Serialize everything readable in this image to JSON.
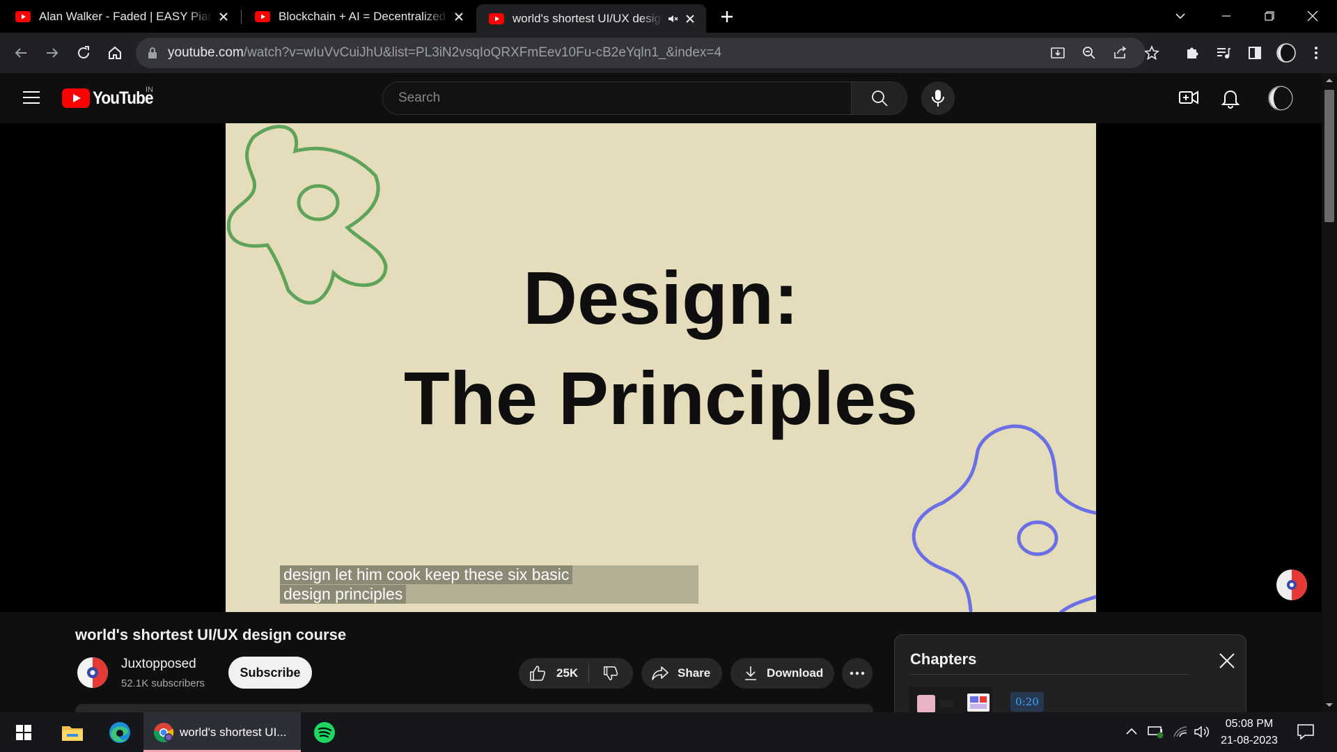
{
  "browser": {
    "tabs": [
      {
        "title": "Alan Walker - Faded | EASY Piano"
      },
      {
        "title": "Blockchain + AI = Decentralized AI"
      },
      {
        "title": "world's shortest UI/UX design course"
      }
    ],
    "url_host": "youtube.com",
    "url_path": "/watch?v=wIuVvCuiJhU&list=PL3iN2vsqIoQRXFmEev10Fu-cB2eYqln1_&index=4"
  },
  "youtube": {
    "logo_text": "YouTube",
    "country_code": "IN",
    "search_placeholder": "Search"
  },
  "video": {
    "slide_line1": "Design:",
    "slide_line2": "The Principles",
    "caption_line1": "design let him cook keep these six basic",
    "caption_line2": "design principles",
    "title": "world's shortest UI/UX design course"
  },
  "channel": {
    "name": "Juxtopposed",
    "subscribers": "52.1K subscribers",
    "subscribe_label": "Subscribe"
  },
  "actions": {
    "likes": "25K",
    "share_label": "Share",
    "download_label": "Download"
  },
  "chapters": {
    "title": "Chapters",
    "first_time": "0:20"
  },
  "taskbar": {
    "chrome_label": "world's shortest UI...",
    "time": "05:08 PM",
    "date": "21-08-2023"
  },
  "colors": {
    "youtube_red": "#ff0000",
    "slide_bg": "#e4dcbb",
    "green_doodle": "#5fa35a",
    "blue_doodle": "#6a6fe6",
    "subscribe_bg": "#f1f1f1",
    "link_blue": "#3ea6ff"
  }
}
